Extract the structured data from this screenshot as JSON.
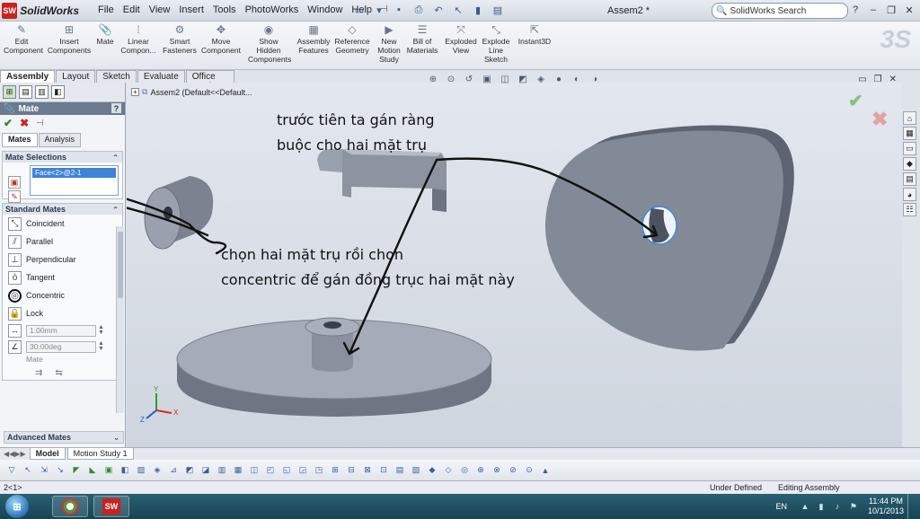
{
  "app": {
    "name": "SolidWorks",
    "logo_mark": "SW",
    "document_title": "Assem2 *"
  },
  "menu": [
    "File",
    "Edit",
    "View",
    "Insert",
    "Tools",
    "PhotoWorks",
    "Window",
    "Help"
  ],
  "search": {
    "placeholder": "SolidWorks Search"
  },
  "ribbon": [
    {
      "label": "Edit Component",
      "icon": "edit-component-icon"
    },
    {
      "label": "Insert Components",
      "icon": "insert-components-icon"
    },
    {
      "label": "Mate",
      "icon": "mate-icon"
    },
    {
      "label": "Linear Compon...",
      "icon": "linear-pattern-icon"
    },
    {
      "label": "Smart Fasteners",
      "icon": "smart-fasteners-icon"
    },
    {
      "label": "Move Component",
      "icon": "move-component-icon"
    },
    {
      "label": "Show Hidden Components",
      "icon": "show-hidden-icon"
    },
    {
      "label": "Assembly Features",
      "icon": "assembly-features-icon"
    },
    {
      "label": "Reference Geometry",
      "icon": "reference-geometry-icon"
    },
    {
      "label": "New Motion Study",
      "icon": "motion-study-icon"
    },
    {
      "label": "Bill of Materials",
      "icon": "bom-icon"
    },
    {
      "label": "Exploded View",
      "icon": "exploded-view-icon"
    },
    {
      "label": "Explode Line Sketch",
      "icon": "explode-line-icon"
    },
    {
      "label": "Instant3D",
      "icon": "instant3d-icon"
    }
  ],
  "cm_tabs": [
    "Assembly",
    "Layout",
    "Sketch",
    "Evaluate",
    "Office Products"
  ],
  "property_manager": {
    "title": "Mate",
    "help": "?",
    "tabs": [
      "Mates",
      "Analysis"
    ],
    "mate_selections": {
      "header": "Mate Selections",
      "items": [
        "Face<2>@2-1"
      ]
    },
    "standard_mates": {
      "header": "Standard Mates",
      "items": [
        {
          "label": "Coincident",
          "icon": "coincident-icon"
        },
        {
          "label": "Parallel",
          "icon": "parallel-icon"
        },
        {
          "label": "Perpendicular",
          "icon": "perpendicular-icon"
        },
        {
          "label": "Tangent",
          "icon": "tangent-icon"
        },
        {
          "label": "Concentric",
          "icon": "concentric-icon",
          "selected": true
        },
        {
          "label": "Lock",
          "icon": "lock-icon"
        }
      ],
      "distance": "1.00mm",
      "angle": "30.00deg",
      "alignment_label": "Mate"
    },
    "advanced": {
      "header": "Advanced Mates"
    }
  },
  "feature_tree": {
    "root": "Assem2  (Default<<Default..."
  },
  "annotations": {
    "top_line1": "trước tiên ta gán ràng",
    "top_line2": "buộc cho hai mặt trụ",
    "mid_line1": "chọn hai mặt trụ rồi chọn",
    "mid_line2": "concentric  để gán đồng trục hai mặt này"
  },
  "bottom_tabs": [
    "Model",
    "Motion Study 1"
  ],
  "status": {
    "left": "2<1>",
    "definition": "Under Defined",
    "mode": "Editing Assembly"
  },
  "taskbar": {
    "language": "EN",
    "time": "11:44 PM",
    "date": "10/1/2013"
  },
  "triad": {
    "x": "X",
    "y": "Y",
    "z": "Z"
  },
  "colors": {
    "accent": "#3f82d6",
    "pm_header": "#6b7a90",
    "taskbar": "#1f5366"
  }
}
